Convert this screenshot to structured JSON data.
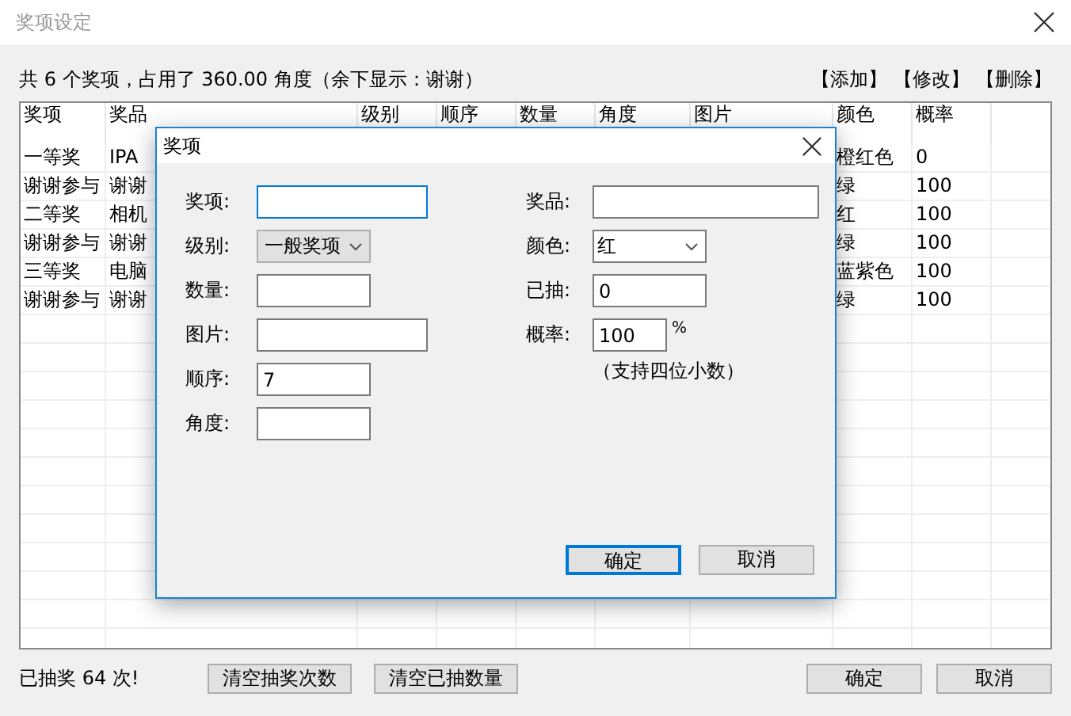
{
  "window": {
    "title": "奖项设定"
  },
  "summary": "共 6 个奖项，占用了 360.00 角度（余下显示：谢谢）",
  "actions": [
    "【添加】",
    "【修改】",
    "【删除】"
  ],
  "table": {
    "columns": [
      "奖项",
      "奖品",
      "级别",
      "顺序",
      "数量",
      "角度",
      "图片",
      "颜色",
      "概率"
    ],
    "rows": [
      {
        "item": "一等奖",
        "prize": "IPA",
        "color_name": "橙红色",
        "rate": "0"
      },
      {
        "item": "谢谢参与",
        "prize": "谢谢",
        "color_name": "绿",
        "rate": "100"
      },
      {
        "item": "二等奖",
        "prize": "相机",
        "color_name": "红",
        "rate": "100"
      },
      {
        "item": "谢谢参与",
        "prize": "谢谢",
        "color_name": "绿",
        "rate": "100"
      },
      {
        "item": "三等奖",
        "prize": "电脑",
        "color_name": "蓝紫色",
        "rate": "100"
      },
      {
        "item": "谢谢参与",
        "prize": "谢谢",
        "color_name": "绿",
        "rate": "100"
      }
    ]
  },
  "dialog": {
    "title": "奖项",
    "left": [
      {
        "label": "奖项:",
        "kind": "text",
        "focused": true
      },
      {
        "label": "级别:",
        "kind": "select",
        "value": "一般奖项",
        "focused": false
      },
      {
        "label": "数量:",
        "kind": "text",
        "focused": false
      },
      {
        "label": "图片:",
        "kind": "text",
        "focused": false
      },
      {
        "label": "顺序:",
        "kind": "text",
        "value": "7",
        "focused": false
      },
      {
        "label": "角度:",
        "kind": "text",
        "focused": false
      }
    ],
    "right": [
      {
        "label": "奖品:",
        "kind": "text",
        "focused": false
      },
      {
        "label": "颜色:",
        "kind": "combo",
        "value": "红",
        "focused": false
      },
      {
        "label": "已抽:",
        "kind": "text",
        "value": "0",
        "focused": false
      },
      {
        "label": "概率:",
        "kind": "text",
        "value": "100",
        "suffix": "%",
        "focused": false
      }
    ],
    "note": "（支持四位小数）",
    "buttons": [
      {
        "label": "确定",
        "default": true
      },
      {
        "label": "取消",
        "default": false
      }
    ]
  },
  "footer": {
    "status": "已抽奖 64 次!",
    "buttons": [
      "清空抽奖次数",
      "清空已抽数量"
    ],
    "dialog_buttons": [
      "确定",
      "取消"
    ]
  }
}
